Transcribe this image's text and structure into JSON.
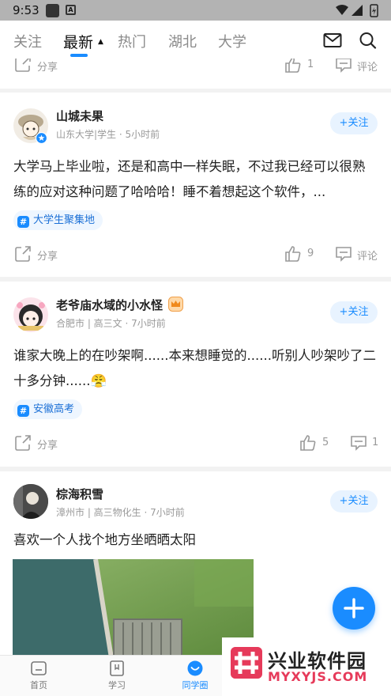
{
  "status_bar": {
    "time": "9:53"
  },
  "top_nav": {
    "tabs": [
      "关注",
      "最新",
      "热门",
      "湖北",
      "大学"
    ],
    "active_tab": "最新"
  },
  "colors": {
    "accent": "#1a8cff",
    "follow_bg": "#e8f3ff",
    "watermark": "#e63a5a"
  },
  "prev_post": {
    "share_label": "分享",
    "likes": "1",
    "comment_label": "评论"
  },
  "posts": [
    {
      "author": "山城未果",
      "meta": "山东大学|学生 · 5小时前",
      "follow_label": "+关注",
      "content": "大学马上毕业啦，还是和高中一样失眠，不过我已经可以很熟练的应对这种问题了哈哈哈！睡不着想起这个软件，...",
      "tag": "大学生聚集地",
      "share_label": "分享",
      "likes": "9",
      "comments": "评论"
    },
    {
      "author": "老爷庙水域的小水怪",
      "meta": "合肥市 | 高三文 · 7小时前",
      "follow_label": "+关注",
      "content": "谁家大晚上的在吵架啊......本来想睡觉的......听别人吵架吵了二十多分钟......😤",
      "tag": "安徽高考",
      "share_label": "分享",
      "likes": "5",
      "comments": "1"
    },
    {
      "author": "棕海积雪",
      "meta": "漳州市 | 高三物化生 · 7小时前",
      "follow_label": "+关注",
      "content": "喜欢一个人找个地方坐晒晒太阳"
    }
  ],
  "bottom_nav": [
    {
      "label": "首页",
      "icon": "home-icon"
    },
    {
      "label": "学习",
      "icon": "study-icon"
    },
    {
      "label": "同学圈",
      "icon": "classmates-icon"
    }
  ],
  "bottom_nav_active": "同学圈",
  "watermark": {
    "title": "兴业软件园",
    "subtitle": "MYXYJS.COM"
  }
}
